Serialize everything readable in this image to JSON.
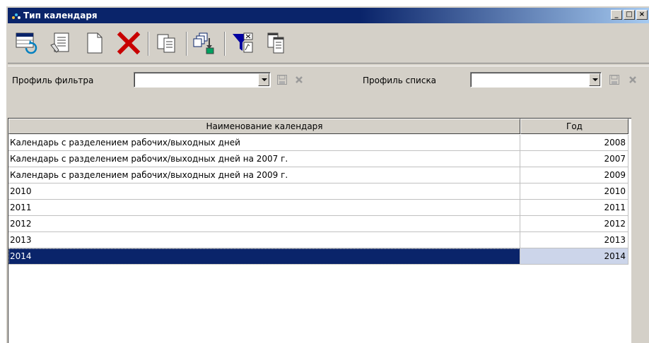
{
  "window": {
    "title": "Тип календаря",
    "controls": {
      "minimize": "_",
      "maximize": "□",
      "close": "×"
    }
  },
  "toolbar": {
    "buttons": [
      {
        "name": "refresh",
        "icon": "refresh-icon"
      },
      {
        "name": "edit",
        "icon": "edit-document-icon"
      },
      {
        "name": "new",
        "icon": "new-document-icon"
      },
      {
        "name": "delete",
        "icon": "delete-icon"
      },
      {
        "name": "copy",
        "icon": "copy-icon"
      },
      {
        "name": "copy-to",
        "icon": "copy-to-icon"
      },
      {
        "name": "filter",
        "icon": "filter-icon"
      },
      {
        "name": "list",
        "icon": "list-view-icon"
      }
    ]
  },
  "filterbar": {
    "filter_profile_label": "Профиль фильтра",
    "filter_profile_value": "",
    "list_profile_label": "Профиль списка",
    "list_profile_value": ""
  },
  "table": {
    "columns": [
      "Наименование календаря",
      "Год"
    ],
    "rows": [
      {
        "name": "Календарь с разделением рабочих/выходных дней",
        "year": "2008"
      },
      {
        "name": "Календарь с разделением рабочих/выходных дней на 2007 г.",
        "year": "2007"
      },
      {
        "name": "Календарь с разделением рабочих/выходных дней на 2009 г.",
        "year": "2009"
      },
      {
        "name": "2010",
        "year": "2010"
      },
      {
        "name": "2011",
        "year": "2011"
      },
      {
        "name": "2012",
        "year": "2012"
      },
      {
        "name": "2013",
        "year": "2013"
      },
      {
        "name": "2014",
        "year": "2014",
        "selected": true
      }
    ]
  }
}
